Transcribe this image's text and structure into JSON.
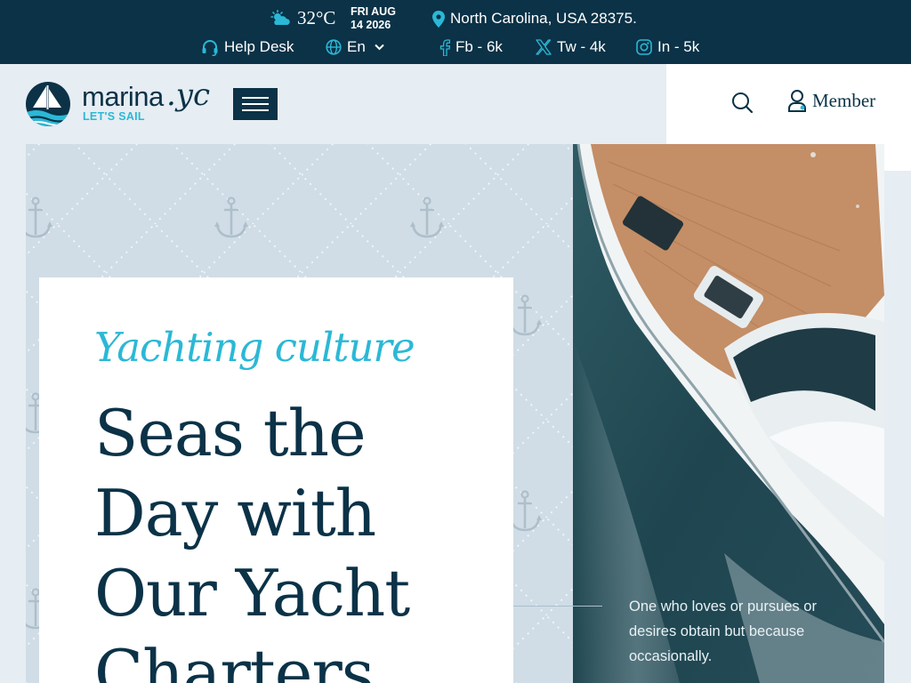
{
  "topbar": {
    "weather": {
      "icon": "partly-cloudy-icon",
      "temperature": "32°C"
    },
    "date": {
      "line1": "FRI AUG",
      "line2": "14 2026"
    },
    "location": {
      "icon": "map-pin-icon",
      "text": "North Carolina, USA 28375."
    },
    "help_desk": {
      "icon": "headset-icon",
      "label": "Help Desk"
    },
    "language": {
      "icon": "globe-icon",
      "selected": "En"
    },
    "social": [
      {
        "icon": "facebook-icon",
        "label": "Fb - 6k"
      },
      {
        "icon": "x-twitter-icon",
        "label": "Tw - 4k"
      },
      {
        "icon": "instagram-icon",
        "label": "In - 5k"
      }
    ]
  },
  "header": {
    "logo": {
      "word": "marina",
      "suffix": ".yc",
      "tagline": "LET'S SAIL"
    },
    "menu_icon": "hamburger-menu-icon",
    "search_icon": "search-icon",
    "member": {
      "icon": "user-icon",
      "label": "Member"
    }
  },
  "hero": {
    "eyebrow": "Yachting culture",
    "headline": "Seas the Day with Our Yacht Charters",
    "caption": "One who loves or pursues or desires obtain but because occasionally.",
    "image": "yacht-aerial-photo"
  },
  "colors": {
    "navy": "#0b3247",
    "accent": "#2bb8d6",
    "page_bg": "#e6edf3",
    "panel_bg": "#d0dde6"
  }
}
